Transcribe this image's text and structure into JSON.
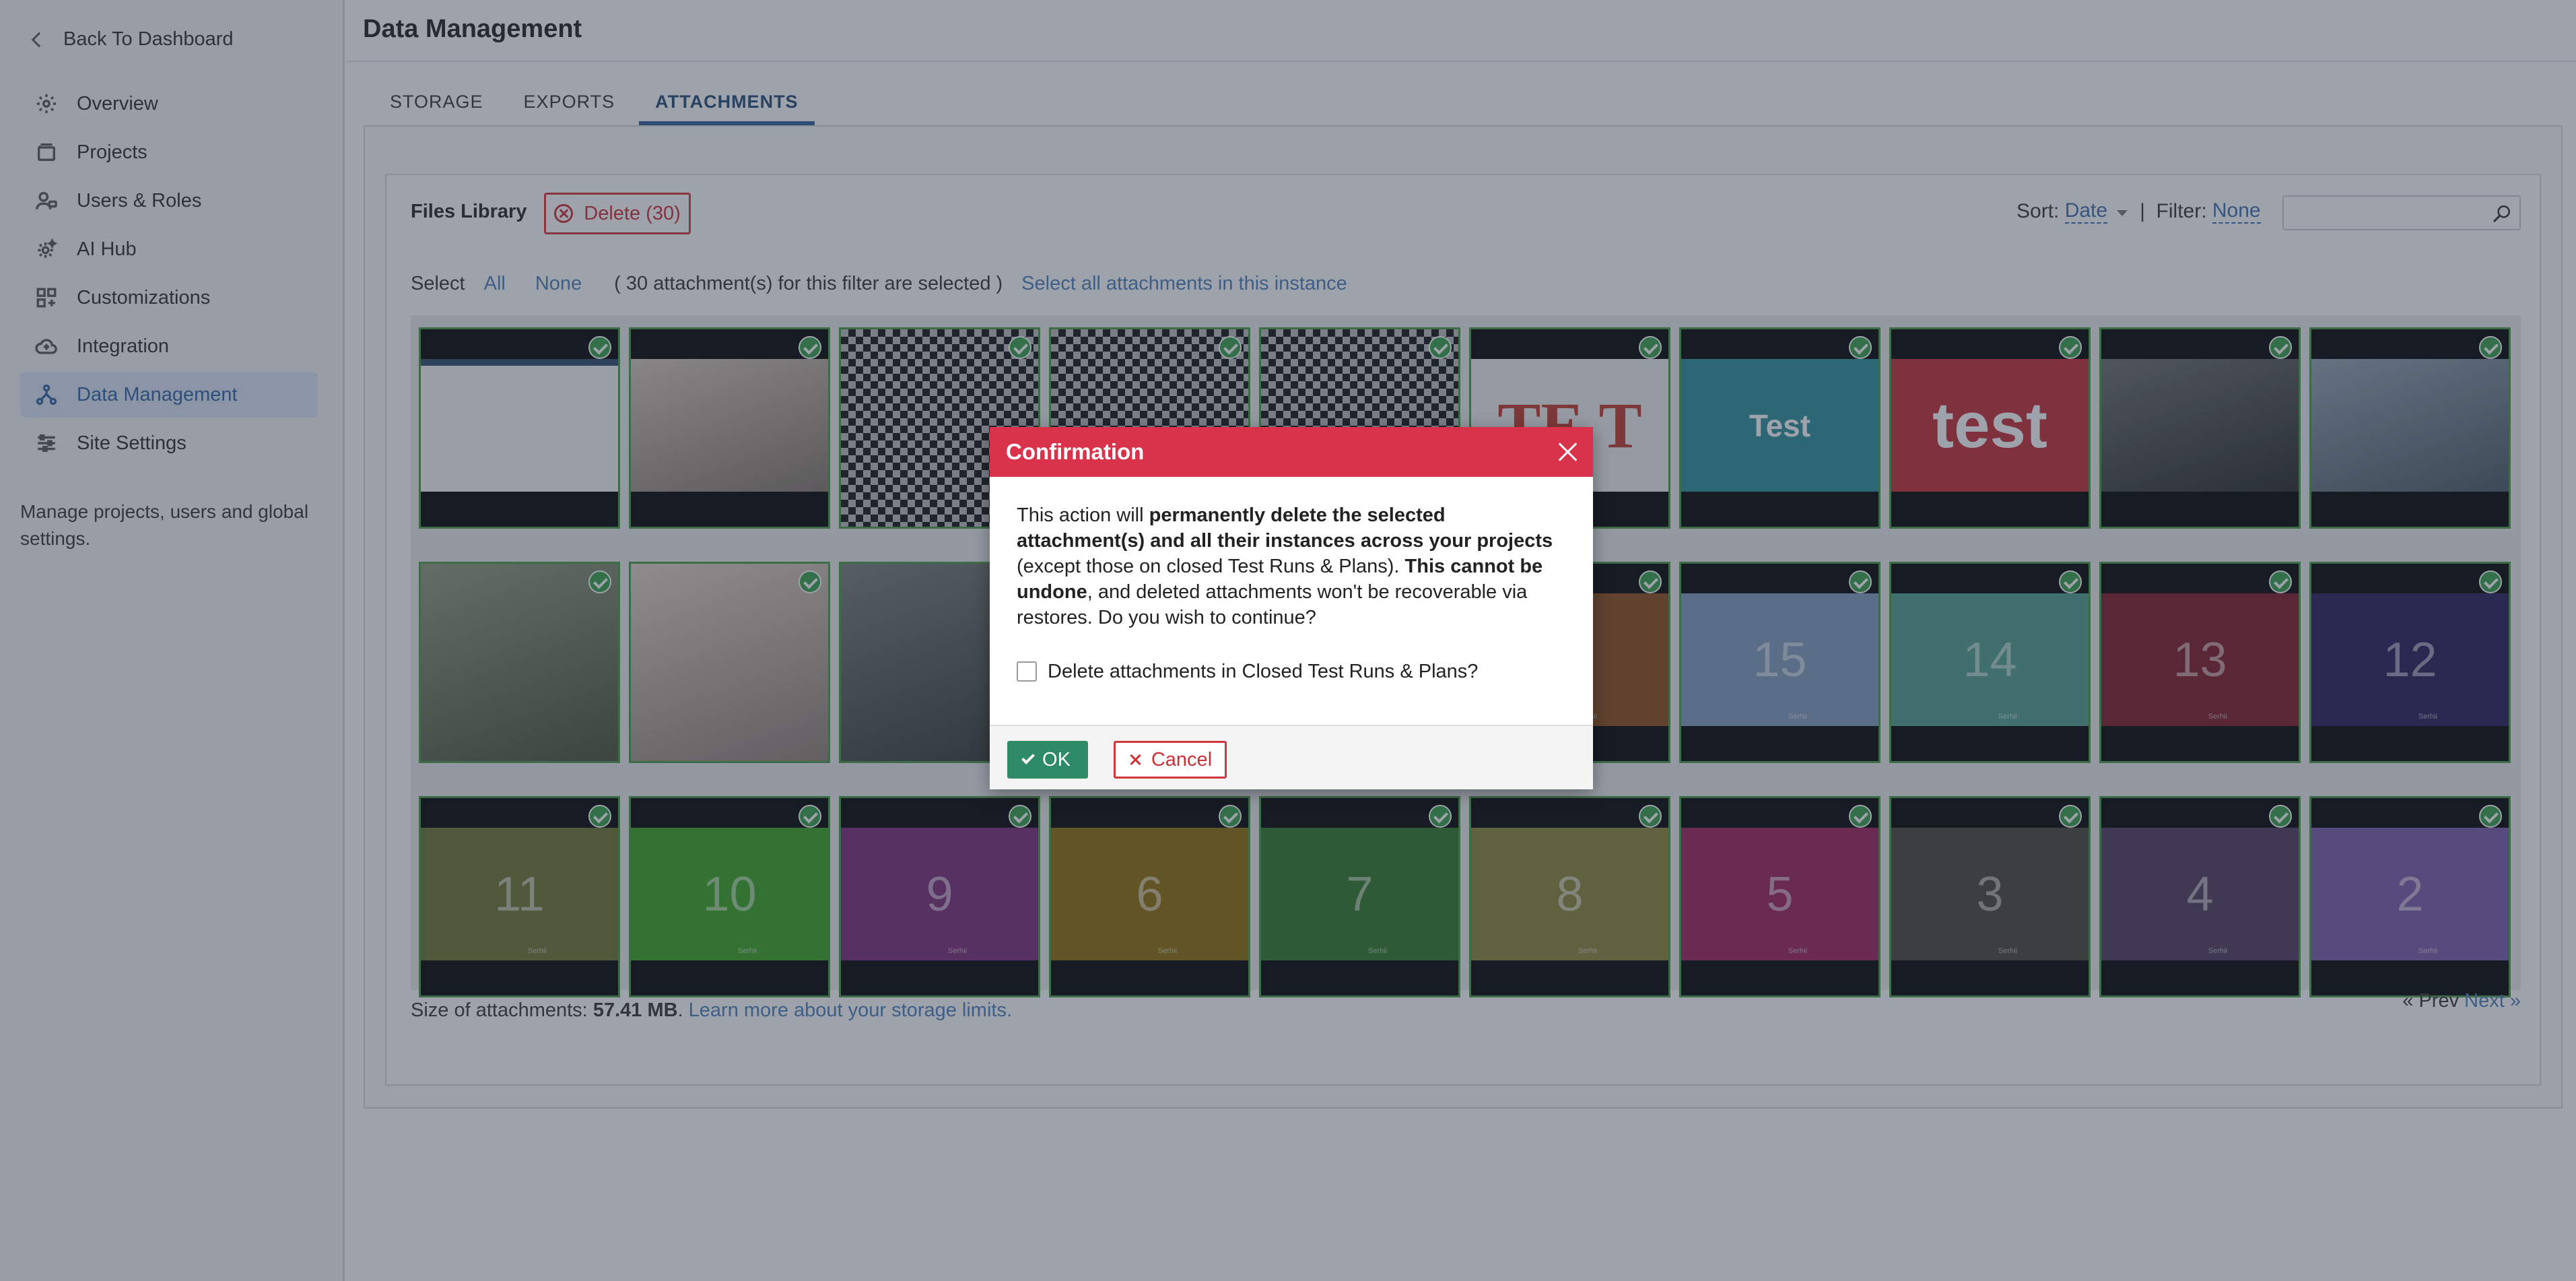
{
  "sidebar": {
    "back_label": "Back To Dashboard",
    "items": [
      {
        "label": "Overview",
        "icon": "gear-icon"
      },
      {
        "label": "Projects",
        "icon": "projects-icon"
      },
      {
        "label": "Users & Roles",
        "icon": "users-icon"
      },
      {
        "label": "AI Hub",
        "icon": "ai-hub-icon"
      },
      {
        "label": "Customizations",
        "icon": "customizations-icon"
      },
      {
        "label": "Integration",
        "icon": "cloud-icon"
      },
      {
        "label": "Data Management",
        "icon": "data-management-icon",
        "active": true
      },
      {
        "label": "Site Settings",
        "icon": "sliders-icon"
      }
    ],
    "note": "Manage projects, users and global settings."
  },
  "header": {
    "title": "Data Management"
  },
  "tabs": [
    {
      "label": "STORAGE"
    },
    {
      "label": "EXPORTS"
    },
    {
      "label": "ATTACHMENTS",
      "active": true
    }
  ],
  "library": {
    "title": "Files Library",
    "delete_label": "Delete",
    "delete_count": "(30)",
    "sort_label": "Sort:",
    "sort_value": "Date",
    "separator": "|",
    "filter_label": "Filter:",
    "filter_value": "None",
    "search_value": "",
    "select_label": "Select",
    "select_all": "All",
    "select_none": "None",
    "selected_note": "( 30 attachment(s) for this filter are selected )",
    "select_instance": "Select all attachments in this instance",
    "size_label": "Size of attachments:",
    "size_value": "57.41 MB",
    "size_link": "Learn more about your storage limits.",
    "prev": "« Prev",
    "next": "Next »"
  },
  "tiles": [
    {
      "label": "",
      "bg": "#dfe6ea",
      "kind": "screenshot"
    },
    {
      "label": "",
      "bg": "#c9b8a6",
      "kind": "photo"
    },
    {
      "label": "",
      "bg": "#555555",
      "kind": "qr"
    },
    {
      "label": "",
      "bg": "#555555",
      "kind": "qr"
    },
    {
      "label": "",
      "bg": "#555555",
      "kind": "qr"
    },
    {
      "label": "",
      "bg": "#f0f0f0",
      "kind": "text",
      "text": "TE T"
    },
    {
      "label": "",
      "bg": "#2a8f9a",
      "kind": "text",
      "text": "Test"
    },
    {
      "label": "",
      "bg": "#c62a34",
      "kind": "text",
      "text": "test"
    },
    {
      "label": "",
      "bg": "#3b3f3f",
      "kind": "photo"
    },
    {
      "label": "",
      "bg": "#6f8799",
      "kind": "photo"
    },
    {
      "label": "",
      "bg": "#6d7a54",
      "kind": "photo"
    },
    {
      "label": "",
      "bg": "#d9c7b6",
      "kind": "photo"
    },
    {
      "label": "",
      "bg": "#4a5450",
      "kind": "photo"
    },
    {
      "label": "",
      "bg": "#3b3b3b",
      "kind": "photo"
    },
    {
      "label": "",
      "bg": "#3b3b3b",
      "kind": "photo"
    },
    {
      "label": "",
      "bg": "#8a4a15",
      "kind": "num"
    },
    {
      "label": "15",
      "bg": "#7f9dbd",
      "kind": "num"
    },
    {
      "label": "14",
      "bg": "#4f9f8c",
      "kind": "num"
    },
    {
      "label": "13",
      "bg": "#7e1822",
      "kind": "num"
    },
    {
      "label": "12",
      "bg": "#221c57",
      "kind": "num"
    },
    {
      "label": "11",
      "bg": "#6c7330",
      "kind": "num"
    },
    {
      "label": "10",
      "bg": "#36a51e",
      "kind": "num"
    },
    {
      "label": "9",
      "bg": "#7a2b78",
      "kind": "num"
    },
    {
      "label": "6",
      "bg": "#8c6e06",
      "kind": "num"
    },
    {
      "label": "7",
      "bg": "#2c7a23",
      "kind": "num"
    },
    {
      "label": "8",
      "bg": "#8a8536",
      "kind": "num"
    },
    {
      "label": "5",
      "bg": "#9c1f5a",
      "kind": "num"
    },
    {
      "label": "3",
      "bg": "#454536",
      "kind": "num"
    },
    {
      "label": "4",
      "bg": "#4d3a5b",
      "kind": "num"
    },
    {
      "label": "2",
      "bg": "#7a5aa8",
      "kind": "num"
    }
  ],
  "tile_sub": "Serhii",
  "modal": {
    "title": "Confirmation",
    "text_1": "This action will ",
    "text_bold_1": "permanently delete the selected attachment(s) and all their instances across your projects",
    "text_2": " (except those on closed Test Runs & Plans). ",
    "text_bold_2": "This cannot be undone",
    "text_3": ", and deleted attachments won't be recoverable via restores. Do you wish to continue?",
    "checkbox_label": "Delete attachments in Closed Test Runs & Plans?",
    "ok_label": "OK",
    "cancel_label": "Cancel"
  },
  "colors": {
    "accent": "#2c63a8",
    "danger": "#d8334a",
    "ok": "#2f8a68",
    "selected_check": "#36a04a"
  }
}
